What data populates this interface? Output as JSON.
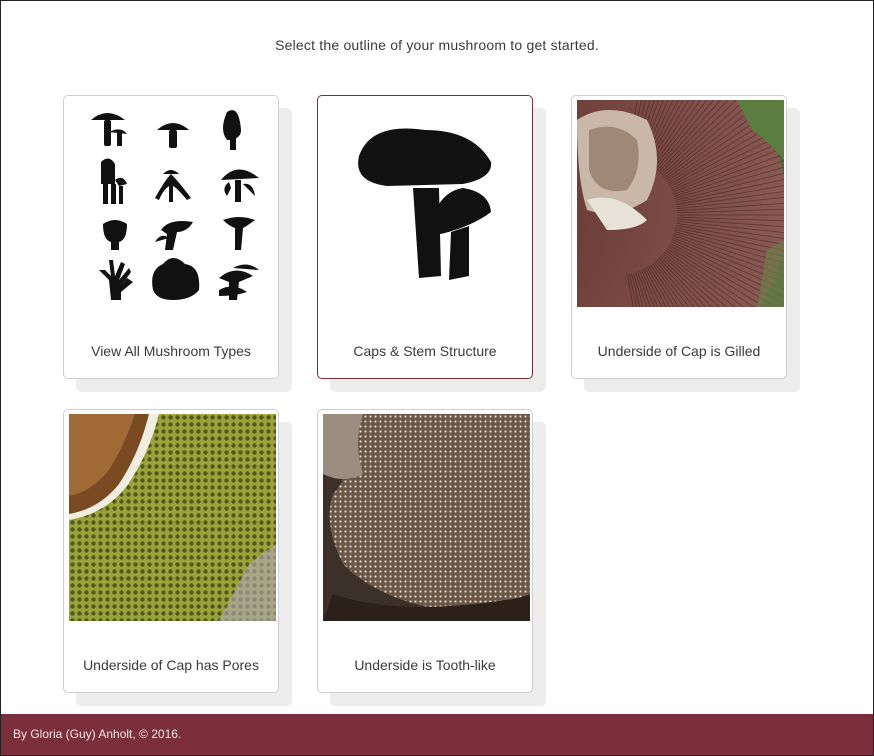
{
  "instruction": "Select the outline of your mushroom to get started.",
  "cards": [
    {
      "label": "View All Mushroom Types",
      "icon": "mushroom-grid-icon"
    },
    {
      "label": "Caps & Stem Structure",
      "icon": "cap-stem-icon"
    },
    {
      "label": "Underside of Cap is Gilled",
      "icon": "gills-photo"
    },
    {
      "label": "Underside of Cap has Pores",
      "icon": "pores-photo"
    },
    {
      "label": "Underside is Tooth-like",
      "icon": "teeth-photo"
    }
  ],
  "footer": {
    "text": "By Gloria (Guy) Anholt, © 2016."
  },
  "colors": {
    "accent": "#7a2f3b",
    "selected_border": "#7b2e3a"
  }
}
